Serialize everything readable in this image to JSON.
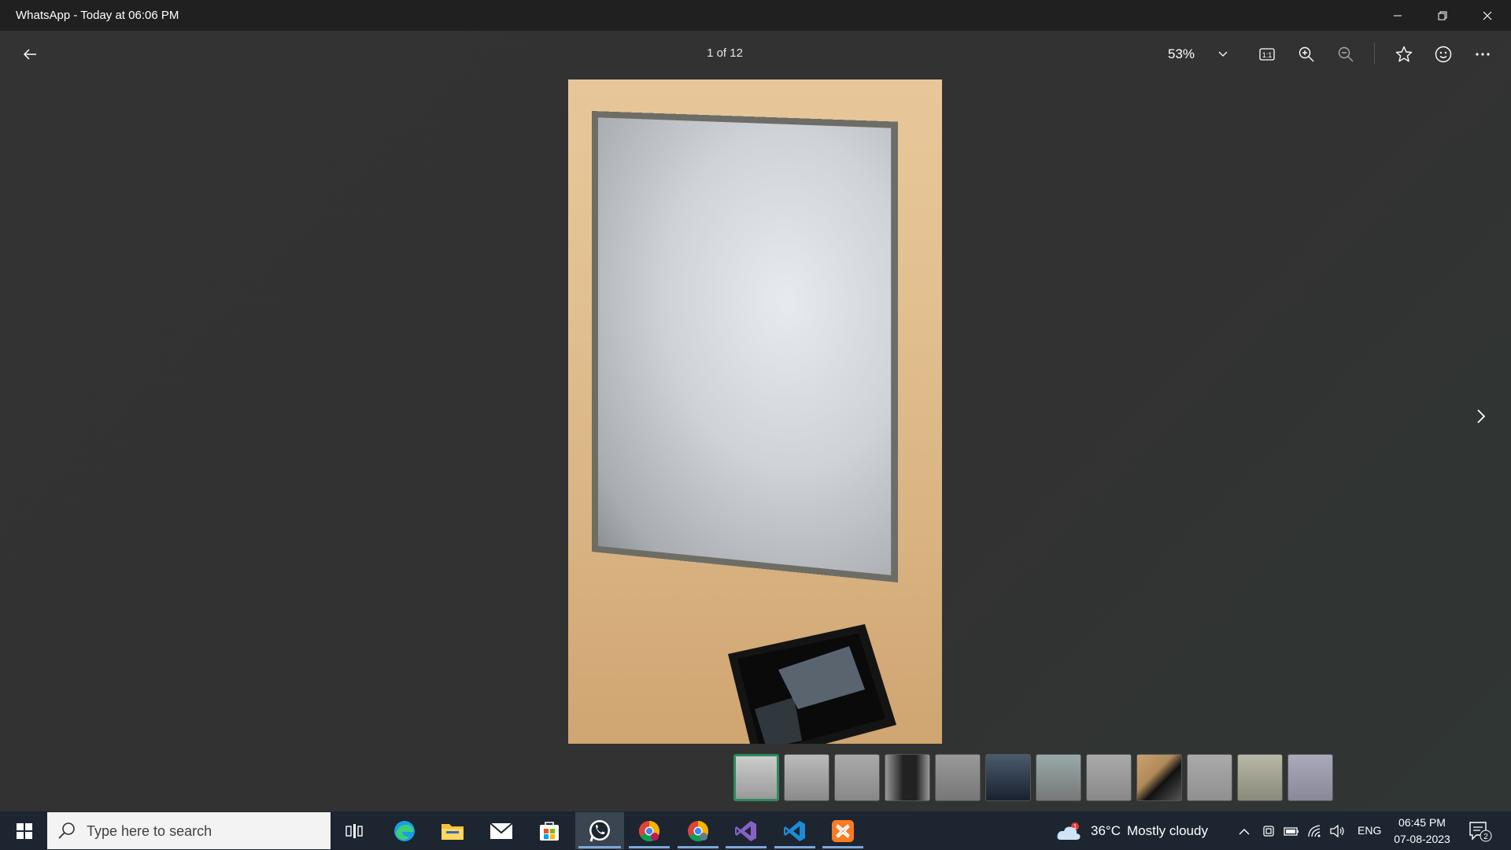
{
  "window": {
    "title": "WhatsApp - Today at 06:06 PM",
    "minimize_icon": "minimize-icon",
    "restore_icon": "restore-icon",
    "close_icon": "close-icon"
  },
  "toolbar": {
    "back_icon": "back-arrow-icon",
    "counter": "1 of 12",
    "zoom": "53%",
    "zoom_dropdown_icon": "chevron-down-icon",
    "actual_size_icon": "actual-size-icon",
    "zoom_in_icon": "zoom-in-icon",
    "zoom_out_icon": "zoom-out-icon",
    "favorite_icon": "star-icon",
    "react_icon": "smiley-icon",
    "more_icon": "more-icon"
  },
  "photo": {
    "description_icon": "whiteboard-photo",
    "next_icon": "chevron-right-icon"
  },
  "filmstrip": {
    "count": 12,
    "active_index": 0
  },
  "taskbar": {
    "search_placeholder": "Type here to search",
    "apps": [
      "task-view",
      "edge",
      "file-explorer",
      "mail",
      "microsoft-store",
      "whatsapp",
      "chrome-profile-1",
      "chrome-profile-2",
      "visual-studio",
      "vs-code",
      "xampp"
    ],
    "weather": {
      "temperature": "36°C",
      "condition": "Mostly cloudy",
      "badge": "1"
    },
    "language": "ENG",
    "time": "06:45 PM",
    "date": "07-08-2023",
    "notification_count": "2"
  }
}
